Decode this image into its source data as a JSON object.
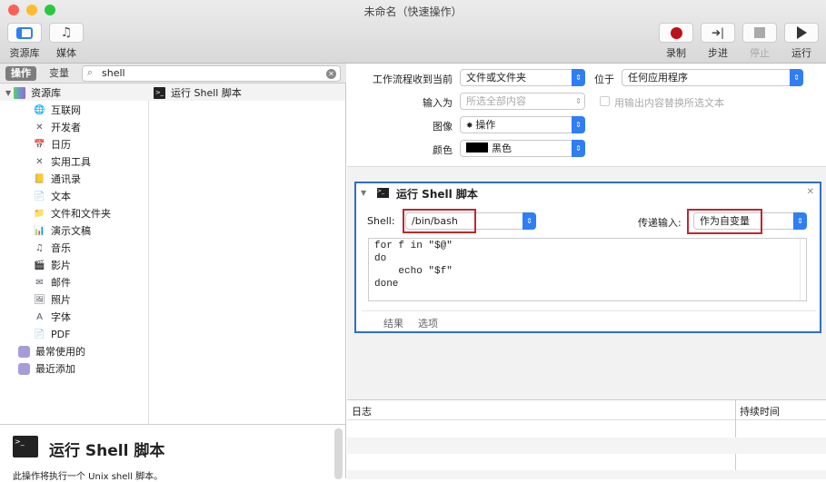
{
  "window": {
    "title": "未命名（快速操作）"
  },
  "toolbar": {
    "library": "资源库",
    "media": "媒体",
    "record": "录制",
    "step": "步进",
    "stop": "停止",
    "run": "运行"
  },
  "left": {
    "tab_actions": "操作",
    "tab_variables": "变量",
    "search_value": "shell",
    "tree_root": "资源库",
    "tree_items": [
      "互联网",
      "开发者",
      "日历",
      "实用工具",
      "通讯录",
      "文本",
      "文件和文件夹",
      "演示文稿",
      "音乐",
      "影片",
      "邮件",
      "照片",
      "字体",
      "PDF"
    ],
    "smart": [
      "最常使用的",
      "最近添加"
    ],
    "result": "运行 Shell 脚本",
    "desc_title": "运行 Shell 脚本",
    "desc_text": "此操作将执行一个 Unix shell 脚本。"
  },
  "config": {
    "receives_label": "工作流程收到当前",
    "receives_value": "文件或文件夹",
    "in_label": "位于",
    "in_value": "任何应用程序",
    "input_label": "输入为",
    "input_value": "所选全部内容",
    "replace_label": "用输出内容替换所选文本",
    "image_label": "图像",
    "image_value": "操作",
    "color_label": "颜色",
    "color_value": "黑色"
  },
  "action": {
    "title": "运行 Shell 脚本",
    "shell_label": "Shell:",
    "shell_value": "/bin/bash",
    "pass_label": "传递输入:",
    "pass_value": "作为自变量",
    "script": "for f in \"$@\"\ndo\n    echo \"$f\"\ndone",
    "tab_results": "结果",
    "tab_options": "选项"
  },
  "log": {
    "col_log": "日志",
    "col_duration": "持续时间"
  },
  "colors": {
    "accent": "#2f7ef5",
    "highlight": "#c0272d",
    "record": "#c0101a"
  }
}
